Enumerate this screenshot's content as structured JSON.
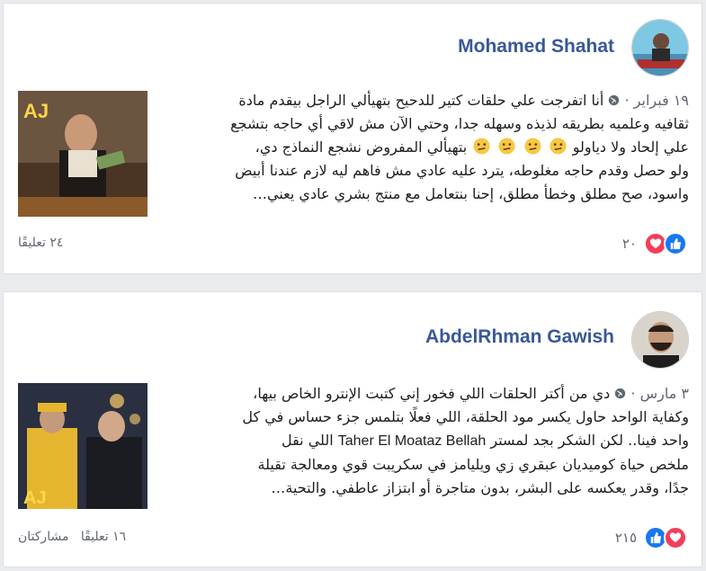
{
  "posts": [
    {
      "author": "Mohamed Shahat",
      "date": "١٩ فبراير",
      "separator": "·",
      "lines": [
        "أنا اتفرجت علي حلقات كتير للدحيح بتهيألي الراجل بيقدم مادة",
        "ثقافيه وعلميه بطريقه لذيذه وسهله جدا، وحتي الآن مش لاقي أي حاجه بتشجع",
        "علي إلحاد ولا دياولو",
        "بتهيألي المفروض نشجع النماذج دي،",
        "ولو حصل وقدم حاجه مغلوطه، يترد عليه عادي مش فاهم ليه لازم عندنا أبيض",
        "واسود، صح مطلق وخطأ مطلق، إحنا بنتعامل مع منتج بشري عادي يعني…"
      ],
      "reaction_count": "٢٠",
      "comments": "٢٤ تعليقًا",
      "shares": ""
    },
    {
      "author": "AbdelRhman Gawish",
      "date": "٣ مارس",
      "separator": "·",
      "lines": [
        "دي من أكتر الحلقات اللي فخور إني كتبت الإنترو الخاص بيها،",
        "وكفاية الواحد حاول يكسر مود الحلقة، اللي فعلًا بتلمس جزء حساس في كل",
        "واحد فينا.. لكن الشكر بجد لمستر",
        "Taher El Moataz Bellah",
        "اللي نقل",
        "ملخص حياة كوميديان عبقري زي ويليامز في سكريبت قوي ومعالجة تقيلة",
        "جدًا، وقدر يعكسه على البشر، بدون متاجرة أو ابتزاز عاطفي. والتحية…"
      ],
      "reaction_count": "٢١٥",
      "comments": "١٦ تعليقًا",
      "shares": "مشاركتان"
    }
  ],
  "icons": {
    "globe": "globe-icon",
    "emoji": "confused-face-icon",
    "like": "like-icon",
    "love": "love-icon"
  },
  "colors": {
    "name": "#385898",
    "like": "#1877f2",
    "love": "#f33e58",
    "meta": "#606770"
  }
}
